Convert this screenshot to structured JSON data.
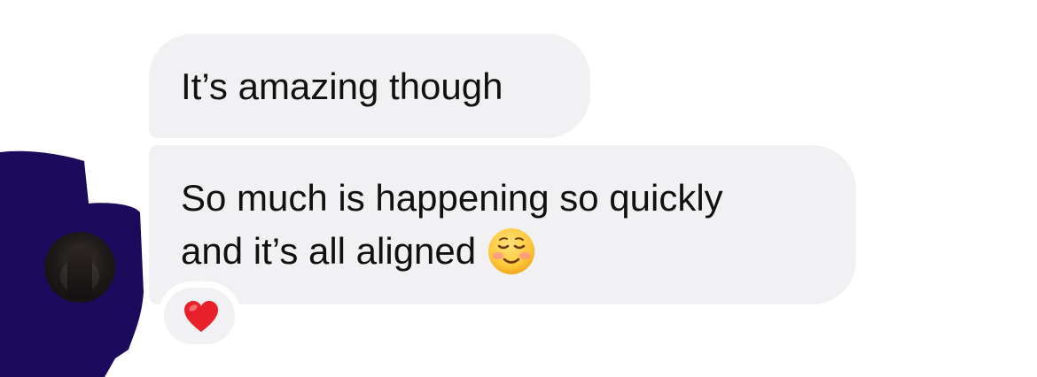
{
  "messages": [
    {
      "lines": [
        "It’s amazing though"
      ]
    },
    {
      "lines": [
        "So much is happening so quickly",
        "and it’s all aligned"
      ],
      "emoji": "smiling-face-icon"
    }
  ],
  "reaction": {
    "icon": "red-heart-icon",
    "color": "#e8202a"
  },
  "colors": {
    "bubble_bg": "#f1f1f3",
    "text": "#111111",
    "redaction": "#1c0b5c"
  }
}
